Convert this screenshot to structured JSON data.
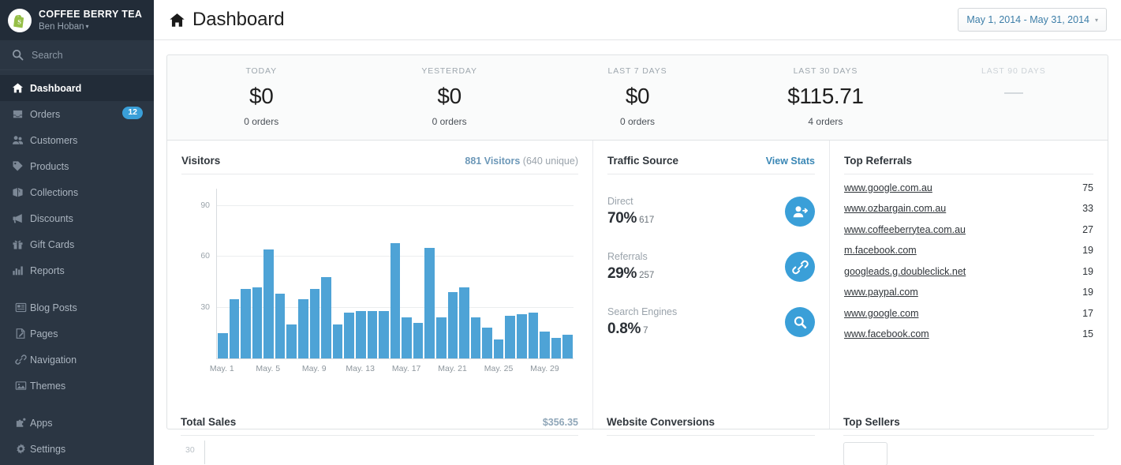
{
  "sidebar": {
    "logo_icon": "shopify-bag-icon",
    "shop_name": "COFFEE BERRY TEA",
    "user_name": "Ben Hoban",
    "user_caret": "▾",
    "search": {
      "icon": "search-icon",
      "placeholder": "Search",
      "label": "Search"
    },
    "items": [
      {
        "label": "Dashboard",
        "icon": "home-icon",
        "active": true,
        "badge": ""
      },
      {
        "label": "Orders",
        "icon": "inbox-icon",
        "active": false,
        "badge": "12"
      },
      {
        "label": "Customers",
        "icon": "people-icon",
        "active": false,
        "badge": ""
      },
      {
        "label": "Products",
        "icon": "tag-icon",
        "active": false,
        "badge": ""
      },
      {
        "label": "Collections",
        "icon": "box-icon",
        "active": false,
        "badge": ""
      },
      {
        "label": "Discounts",
        "icon": "megaphone-icon",
        "active": false,
        "badge": ""
      },
      {
        "label": "Gift Cards",
        "icon": "gift-icon",
        "active": false,
        "badge": ""
      },
      {
        "label": "Reports",
        "icon": "bar-chart-icon",
        "active": false,
        "badge": ""
      },
      {
        "label": "Blog Posts",
        "icon": "newspaper-icon",
        "active": false,
        "badge": ""
      },
      {
        "label": "Pages",
        "icon": "page-edit-icon",
        "active": false,
        "badge": ""
      },
      {
        "label": "Navigation",
        "icon": "link-icon",
        "active": false,
        "badge": ""
      },
      {
        "label": "Themes",
        "icon": "image-icon",
        "active": false,
        "badge": ""
      },
      {
        "label": "Apps",
        "icon": "puzzle-icon",
        "active": false,
        "badge": ""
      },
      {
        "label": "Settings",
        "icon": "gear-icon",
        "active": false,
        "badge": ""
      }
    ],
    "gap_after_index": [
      7,
      11
    ]
  },
  "header": {
    "home_icon": "home-icon",
    "title": "Dashboard",
    "daterange": {
      "label": "May 1, 2014 - May 31, 2014",
      "caret": "▾"
    }
  },
  "stats": [
    {
      "label": "TODAY",
      "value": "$0",
      "sub": "0 orders",
      "muted": false
    },
    {
      "label": "YESTERDAY",
      "value": "$0",
      "sub": "0 orders",
      "muted": false
    },
    {
      "label": "LAST 7 DAYS",
      "value": "$0",
      "sub": "0 orders",
      "muted": false
    },
    {
      "label": "LAST 30 DAYS",
      "value": "$115.71",
      "sub": "4 orders",
      "muted": false
    },
    {
      "label": "LAST 90 DAYS",
      "value": "",
      "sub": "",
      "muted": true
    }
  ],
  "visitors": {
    "title": "Visitors",
    "meta_bold": "881 Visitors",
    "meta_rest": " (640 unique)"
  },
  "traffic": {
    "title": "Traffic Source",
    "link": "View Stats",
    "rows": [
      {
        "label": "Direct",
        "percent": "70%",
        "count": "617",
        "icon": "add-user-icon"
      },
      {
        "label": "Referrals",
        "percent": "29%",
        "count": "257",
        "icon": "link-icon"
      },
      {
        "label": "Search Engines",
        "percent": "0.8%",
        "count": "7",
        "icon": "search-icon"
      }
    ]
  },
  "referrals": {
    "title": "Top Referrals",
    "rows": [
      {
        "name": "www.google.com.au",
        "count": "75"
      },
      {
        "name": "www.ozbargain.com.au",
        "count": "33"
      },
      {
        "name": "www.coffeeberrytea.com.au",
        "count": "27"
      },
      {
        "name": "m.facebook.com",
        "count": "19"
      },
      {
        "name": "googleads.g.doubleclick.net",
        "count": "19"
      },
      {
        "name": "www.paypal.com",
        "count": "19"
      },
      {
        "name": "www.google.com",
        "count": "17"
      },
      {
        "name": "www.facebook.com",
        "count": "15"
      }
    ]
  },
  "bottom": {
    "total_sales": {
      "title": "Total Sales",
      "amount": "$356.35",
      "ytick": "30"
    },
    "conversions": {
      "title": "Website Conversions"
    },
    "top_sellers": {
      "title": "Top Sellers"
    }
  },
  "chart_data": {
    "type": "bar",
    "title": "Visitors",
    "xlabel": "",
    "ylabel": "",
    "ylim": [
      0,
      100
    ],
    "yticks": [
      30,
      60,
      90
    ],
    "grid": true,
    "legend": false,
    "bar_color": "#4ea3d6",
    "x": [
      "May. 1",
      "May. 2",
      "May. 3",
      "May. 4",
      "May. 5",
      "May. 6",
      "May. 7",
      "May. 8",
      "May. 9",
      "May. 10",
      "May. 11",
      "May. 12",
      "May. 13",
      "May. 14",
      "May. 15",
      "May. 16",
      "May. 17",
      "May. 18",
      "May. 19",
      "May. 20",
      "May. 21",
      "May. 22",
      "May. 23",
      "May. 24",
      "May. 25",
      "May. 26",
      "May. 27",
      "May. 28",
      "May. 29",
      "May. 30",
      "May. 31"
    ],
    "tick_labels": [
      "May. 1",
      "May. 5",
      "May. 9",
      "May. 13",
      "May. 17",
      "May. 21",
      "May. 25",
      "May. 29"
    ],
    "values": [
      15,
      35,
      41,
      42,
      64,
      38,
      20,
      35,
      41,
      48,
      20,
      27,
      28,
      28,
      28,
      68,
      24,
      21,
      65,
      24,
      39,
      42,
      24,
      18,
      11,
      25,
      26,
      27,
      16,
      12,
      14
    ],
    "total_visitors": 881,
    "unique_visitors": 640
  }
}
